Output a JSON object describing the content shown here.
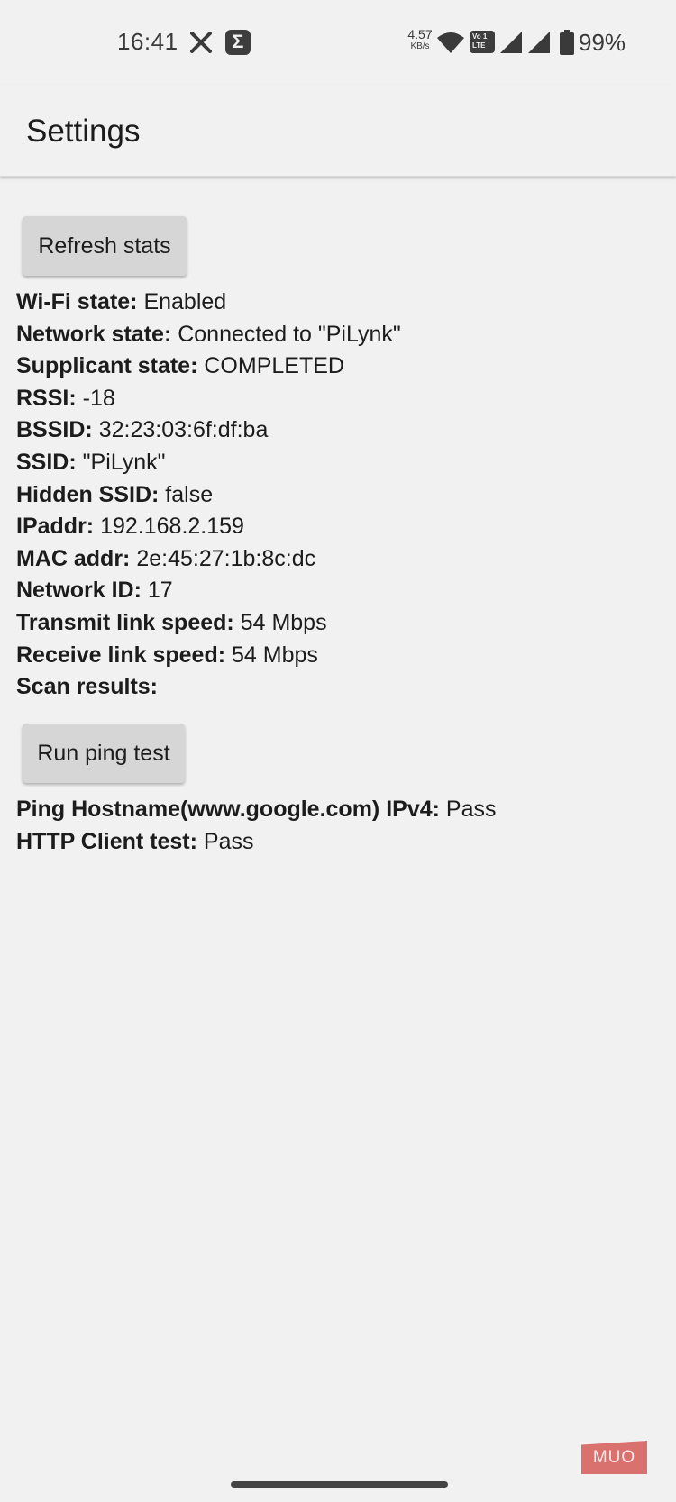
{
  "status_bar": {
    "time": "16:41",
    "net_speed_value": "4.57",
    "net_speed_unit": "KB/s",
    "volte_label_top": "Vo 1",
    "volte_label_bottom": "LTE",
    "battery_percent": "99%",
    "icons": [
      "x-icon",
      "sigma-icon",
      "wifi-icon",
      "volte-icon",
      "signal-icon",
      "signal-icon",
      "battery-icon"
    ]
  },
  "app_bar": {
    "title": "Settings"
  },
  "refresh_button": {
    "label": "Refresh stats"
  },
  "stats": [
    {
      "key": "Wi-Fi state:",
      "value": "Enabled"
    },
    {
      "key": "Network state:",
      "value": "Connected to \"PiLynk\""
    },
    {
      "key": "Supplicant state:",
      "value": "COMPLETED"
    },
    {
      "key": "RSSI:",
      "value": "-18"
    },
    {
      "key": "BSSID:",
      "value": "32:23:03:6f:df:ba"
    },
    {
      "key": "SSID:",
      "value": "\"PiLynk\""
    },
    {
      "key": "Hidden SSID:",
      "value": "false"
    },
    {
      "key": "IPaddr:",
      "value": "192.168.2.159"
    },
    {
      "key": "MAC addr:",
      "value": "2e:45:27:1b:8c:dc"
    },
    {
      "key": "Network ID:",
      "value": "17"
    },
    {
      "key": "Transmit link speed:",
      "value": "54 Mbps"
    },
    {
      "key": "Receive link speed:",
      "value": "54 Mbps"
    },
    {
      "key": "Scan results:",
      "value": ""
    }
  ],
  "ping_button": {
    "label": "Run ping test"
  },
  "ping_results": [
    {
      "key": "Ping Hostname(www.google.com) IPv4:",
      "value": "Pass"
    },
    {
      "key": "HTTP Client test:",
      "value": "Pass"
    }
  ],
  "watermark": {
    "text": "MUO"
  },
  "colors": {
    "background": "#f1f1f1",
    "button": "#d6d6d6",
    "watermark": "#d9726f"
  }
}
